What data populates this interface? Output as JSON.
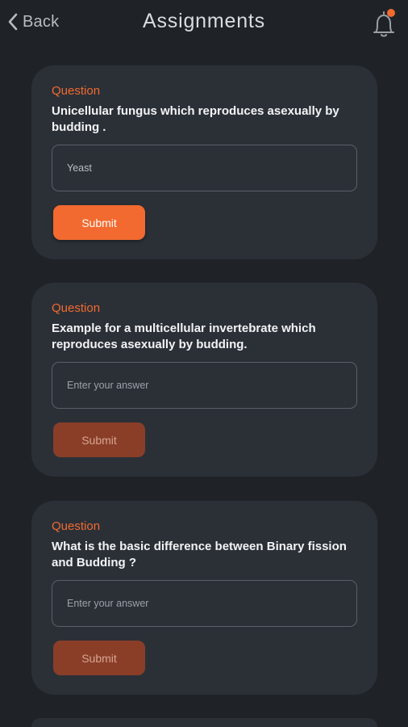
{
  "header": {
    "back_label": "Back",
    "title": "Assignments",
    "notification_dot_color": "#f26a2f"
  },
  "questions": [
    {
      "label": "Question",
      "text": "Unicellular fungus which reproduces asexually by budding .",
      "answer_value": "Yeast",
      "answer_placeholder": "",
      "submit_label": "Submit",
      "submit_state": "active"
    },
    {
      "label": "Question",
      "text": "Example for a multicellular invertebrate which reproduces asexually by budding.",
      "answer_value": "",
      "answer_placeholder": "Enter your answer",
      "submit_label": "Submit",
      "submit_state": "inactive"
    },
    {
      "label": "Question",
      "text": "What is the basic difference between Binary fission and Budding ?",
      "answer_value": "",
      "answer_placeholder": "Enter your answer",
      "submit_label": "Submit",
      "submit_state": "inactive"
    }
  ],
  "colors": {
    "background": "#1f2328",
    "card": "#2b3037",
    "accent": "#f26a2f",
    "submit_disabled": "#8a3e28"
  }
}
